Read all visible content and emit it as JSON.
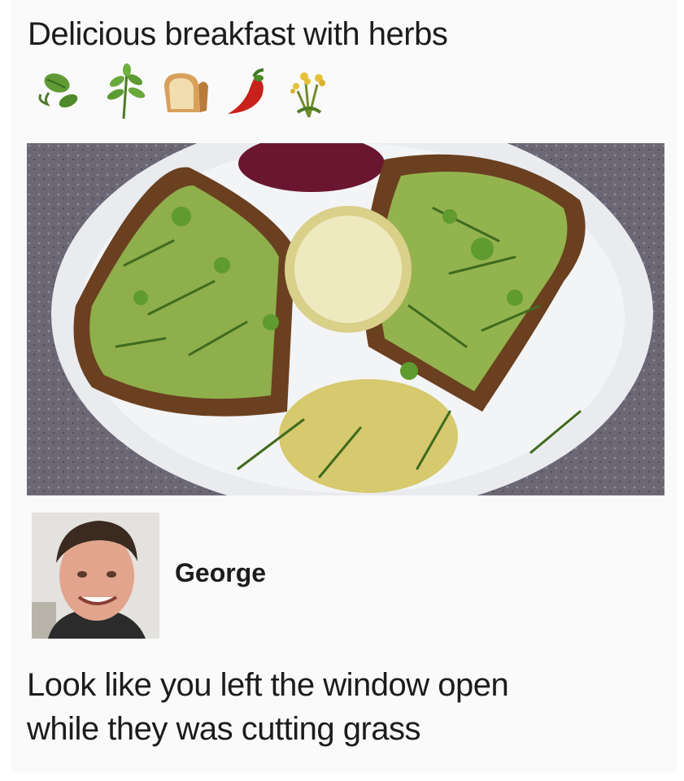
{
  "post": {
    "caption": "Delicious breakfast with herbs",
    "emojis": [
      {
        "icon": "leaf-herb-icon"
      },
      {
        "icon": "herb-sprig-icon"
      },
      {
        "icon": "bread-icon"
      },
      {
        "icon": "hot-pepper-icon"
      },
      {
        "icon": "sheaf-of-rice-icon"
      }
    ]
  },
  "comment": {
    "author": "George",
    "lines": [
      "Look like you left the window open",
      "while they was cutting grass"
    ]
  }
}
